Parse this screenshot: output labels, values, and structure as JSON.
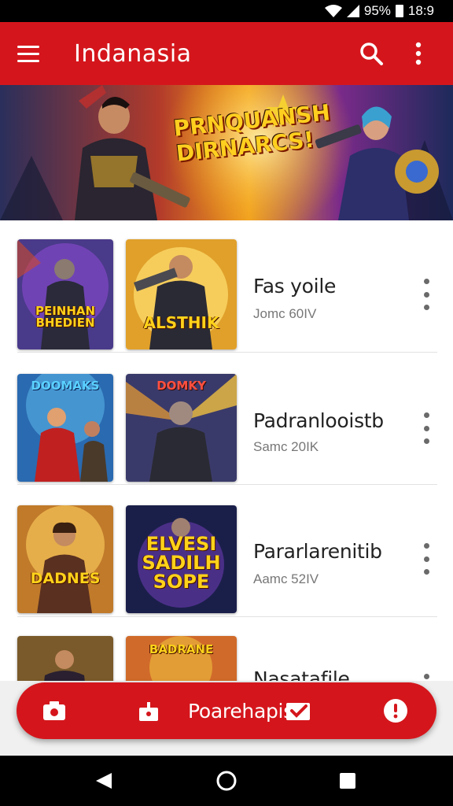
{
  "status_bar": {
    "battery": "95%",
    "time": "18:9"
  },
  "app_bar": {
    "title": "Indanasia",
    "menu_icon": "menu-icon",
    "search_icon": "search-icon",
    "more_icon": "more-vert-icon"
  },
  "banner": {
    "headline": "PRNQUANSH DIRNARCS!"
  },
  "list": {
    "items": [
      {
        "title": "Fas yoile",
        "subtitle": "Jomc 60IV",
        "thumb_a_text": "PEINHAN BHEDIEN",
        "thumb_b_text": "ALSTHIK"
      },
      {
        "title": "Padranlooistb",
        "subtitle": "Samc 20IK",
        "thumb_a_text": "DOOMAKS",
        "thumb_b_text": "DOMKY"
      },
      {
        "title": "Pararlarenitib",
        "subtitle": "Aamc 52IV",
        "thumb_a_text": "DADNES",
        "thumb_b_text": "ELVESI SADILH SOPE"
      },
      {
        "title": "Nasatafile",
        "subtitle": "",
        "thumb_a_text": "",
        "thumb_b_text": "BADRANE"
      }
    ]
  },
  "bottom_bar": {
    "label": "Poarehapis",
    "icons": [
      "camera-icon",
      "gift-icon",
      "mail-check-icon",
      "info-icon"
    ]
  },
  "nav_bar": {
    "icons": [
      "back-icon",
      "home-icon",
      "recents-icon"
    ]
  },
  "colors": {
    "brand_red": "#d4161c",
    "text_dark": "#222222",
    "text_gray": "#777777"
  }
}
